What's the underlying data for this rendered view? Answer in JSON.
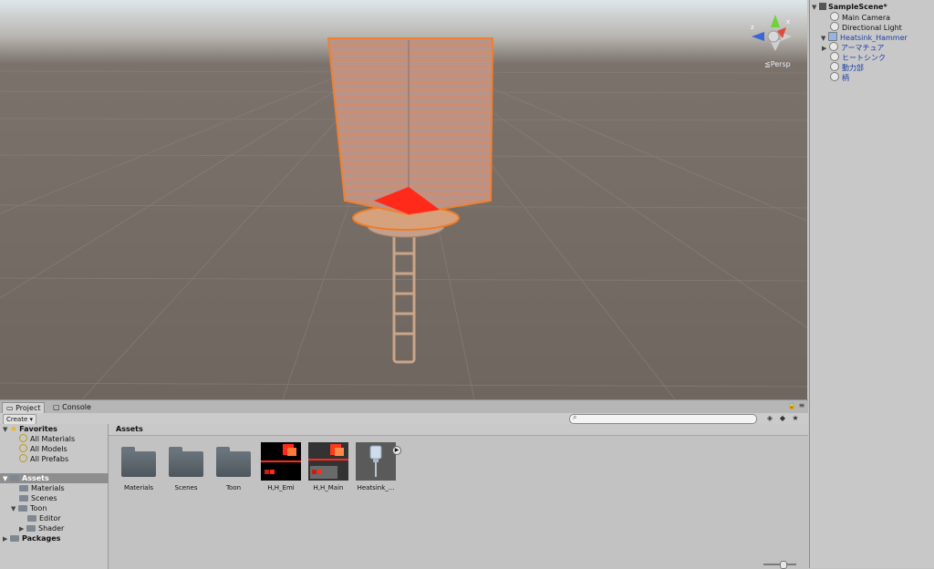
{
  "scene": {
    "projection_label": "Persp",
    "gizmo_axes": {
      "x": "x",
      "z": "z"
    }
  },
  "hierarchy": {
    "scene_name": "SampleScene*",
    "items": [
      {
        "label": "Main Camera",
        "color": "#111111"
      },
      {
        "label": "Directional Light",
        "color": "#111111"
      },
      {
        "label": "Heatsink_Hammer",
        "color": "#1b3fa6"
      },
      {
        "label": "アーマチュア",
        "color": "#1b3fa6"
      },
      {
        "label": "ヒートシンク",
        "color": "#1b3fa6"
      },
      {
        "label": "動力部",
        "color": "#1b3fa6"
      },
      {
        "label": "柄",
        "color": "#1b3fa6"
      }
    ]
  },
  "bottom": {
    "tabs": {
      "project": "Project",
      "console": "Console"
    },
    "create_label": "Create",
    "search_placeholder": "",
    "tree": {
      "favorites": "Favorites",
      "fav_items": [
        "All Materials",
        "All Models",
        "All Prefabs"
      ],
      "assets": "Assets",
      "asset_items": [
        "Materials",
        "Scenes",
        "Toon",
        "Editor",
        "Shader"
      ],
      "packages": "Packages"
    },
    "breadcrumb": "Assets",
    "assets": [
      {
        "label": "Materials",
        "kind": "folder"
      },
      {
        "label": "Scenes",
        "kind": "folder"
      },
      {
        "label": "Toon",
        "kind": "folder"
      },
      {
        "label": "H,H_Emi",
        "kind": "texture"
      },
      {
        "label": "H,H_Main",
        "kind": "texture"
      },
      {
        "label": "Heatsink_...",
        "kind": "model"
      }
    ]
  }
}
